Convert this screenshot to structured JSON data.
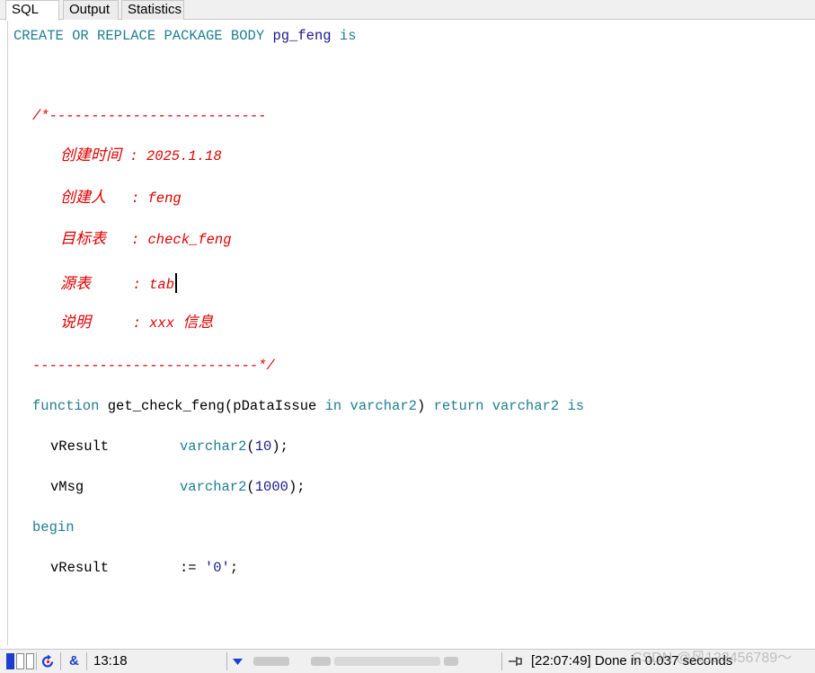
{
  "tabs": [
    {
      "label": "SQL"
    },
    {
      "label": "Output"
    },
    {
      "label": "Statistics"
    }
  ],
  "code": {
    "l1": {
      "a": "CREATE",
      "b": "OR",
      "c": "REPLACE",
      "d": "PACKAGE",
      "e": "BODY",
      "f": "pg_feng",
      "g": "is"
    },
    "comment_open": "/*--------------------------",
    "c1_label": "创建时间",
    "c1_rest": " : 2025.1.18",
    "c2_label": "创建人",
    "c2_rest": "   : feng",
    "c3_label": "目标表",
    "c3_rest": "   : check_feng",
    "c4_label": "源表",
    "c4_rest": "     : tab",
    "c5_label": "说明",
    "c5_rest": "     : xxx ",
    "c5_tail": "信息",
    "comment_close": "---------------------------*/",
    "fn": {
      "kw1": "function",
      "name": "get_check_feng",
      "lp": "(",
      "param": "pDataIssue",
      "kw2": "in",
      "type1": "varchar2",
      "rp": ")",
      "kw3": "return",
      "type2": "varchar2",
      "kw4": "is"
    },
    "v1": {
      "name": "vResult",
      "type": "varchar2",
      "lp": "(",
      "num": "10",
      "rp": ");"
    },
    "v2": {
      "name": "vMsg",
      "type": "varchar2",
      "lp": "(",
      "num": "1000",
      "rp": ");"
    },
    "begin": "begin",
    "assign": {
      "name": "vResult",
      "op": ":=",
      "val": "'0'",
      "end": ";"
    }
  },
  "status": {
    "position": "13:18",
    "amp": "&",
    "message": "[22:07:49]  Done in 0.037 seconds",
    "watermark": "CSDN @风123456789～"
  },
  "colors": {
    "keyword": "#1f7f8f",
    "identifier": "#1a1a8c",
    "comment": "#e00000"
  }
}
